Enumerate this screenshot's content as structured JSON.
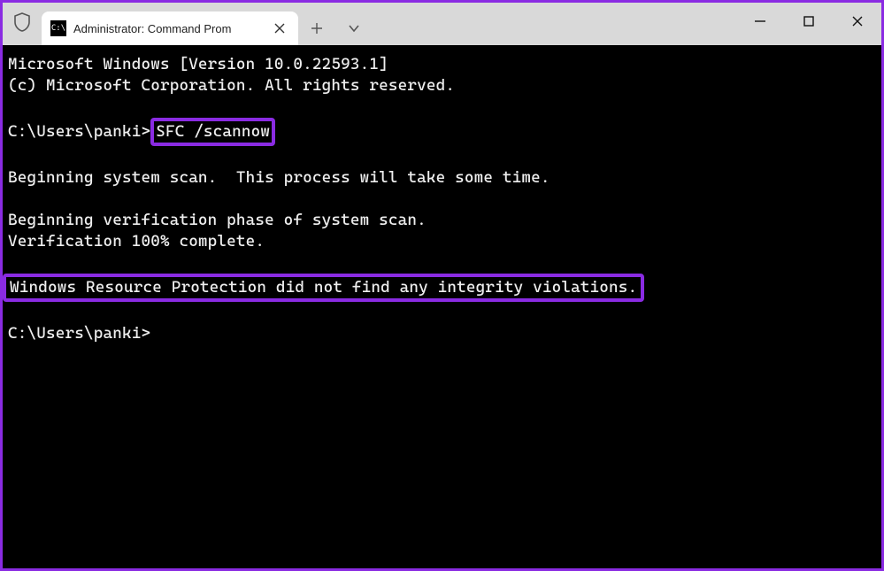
{
  "titlebar": {
    "tab_title": "Administrator: Command Prom",
    "tab_cmd_glyph": "C:\\"
  },
  "terminal": {
    "header_line1": "Microsoft Windows [Version 10.0.22593.1]",
    "header_line2": "(c) Microsoft Corporation. All rights reserved.",
    "prompt1_path": "C:\\Users\\panki>",
    "prompt1_cmd": "SFC /scannow",
    "scan_line1": "Beginning system scan.  This process will take some time.",
    "scan_line2": "Beginning verification phase of system scan.",
    "scan_line3": "Verification 100% complete.",
    "result_line": "Windows Resource Protection did not find any integrity violations.",
    "prompt2": "C:\\Users\\panki>"
  },
  "highlight_color": "#8a2be2"
}
